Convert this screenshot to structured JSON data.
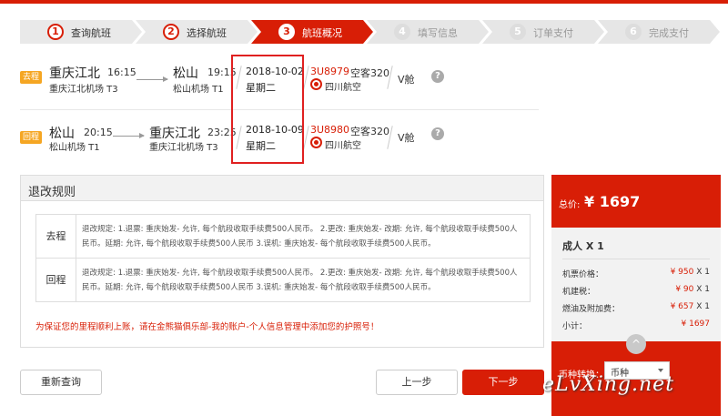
{
  "steps": [
    {
      "num": "1",
      "label": "查询航班"
    },
    {
      "num": "2",
      "label": "选择航班"
    },
    {
      "num": "3",
      "label": "航班概况"
    },
    {
      "num": "4",
      "label": "填写信息"
    },
    {
      "num": "5",
      "label": "订单支付"
    },
    {
      "num": "6",
      "label": "完成支付"
    }
  ],
  "outbound": {
    "badge": "去程",
    "dep_city": "重庆江北",
    "dep_time": "16:15",
    "dep_airport": "重庆江北机场  T3",
    "arr_city": "松山",
    "arr_time": "19:15",
    "arr_airport": "松山机场  T1",
    "date": "2018-10-02",
    "weekday": "星期二",
    "flight_no": "3U8979",
    "aircraft": "空客320",
    "airline": "四川航空",
    "cabin": "V舱",
    "help": "?"
  },
  "return": {
    "badge": "回程",
    "dep_city": "松山",
    "dep_time": "20:15",
    "dep_airport": "松山机场  T1",
    "arr_city": "重庆江北",
    "arr_time": "23:25",
    "arr_airport": "重庆江北机场  T3",
    "date": "2018-10-09",
    "weekday": "星期二",
    "flight_no": "3U8980",
    "aircraft": "空客320",
    "airline": "四川航空",
    "cabin": "V舱",
    "help": "?"
  },
  "rules": {
    "title": "退改规则",
    "rows": [
      {
        "label": "去程",
        "text": "退改规定: 1.退票: 重庆始发- 允许, 每个航段收取手续费500人民币。 2.更改: 重庆始发- 改期: 允许, 每个航段收取手续费500人民币。延期: 允许, 每个航段收取手续费500人民币 3.误机: 重庆始发- 每个航段收取手续费500人民币。"
      },
      {
        "label": "回程",
        "text": "退改规定: 1.退票: 重庆始发- 允许, 每个航段收取手续费500人民币。 2.更改: 重庆始发- 改期: 允许, 每个航段收取手续费500人民币。延期: 允许, 每个航段收取手续费500人民币 3.误机: 重庆始发- 每个航段收取手续费500人民币。"
      }
    ],
    "notice": "为保证您的里程顺利上账，请在金熊猫俱乐部-我的账户-个人信息管理中添加您的护照号！"
  },
  "price": {
    "total_label": "总价:",
    "total": "¥ 1697",
    "adult": "成人 X 1",
    "items": [
      {
        "label": "机票价格：",
        "value": "¥ 950",
        "qty": "X 1"
      },
      {
        "label": "机建税：",
        "value": "¥ 90",
        "qty": "X 1"
      },
      {
        "label": "燃油及附加费：",
        "value": "¥ 657",
        "qty": "X 1"
      },
      {
        "label": "小计：",
        "value": "¥ 1697",
        "qty": ""
      }
    ],
    "up_icon": "^",
    "currency_label": "币种转换：",
    "currency_value": "币种"
  },
  "buttons": {
    "requery": "重新查询",
    "prev": "上一步",
    "next": "下一步"
  },
  "watermark": "eLvXing.net",
  "colors": {
    "accent": "#d81e06",
    "badge": "#f5a623"
  }
}
